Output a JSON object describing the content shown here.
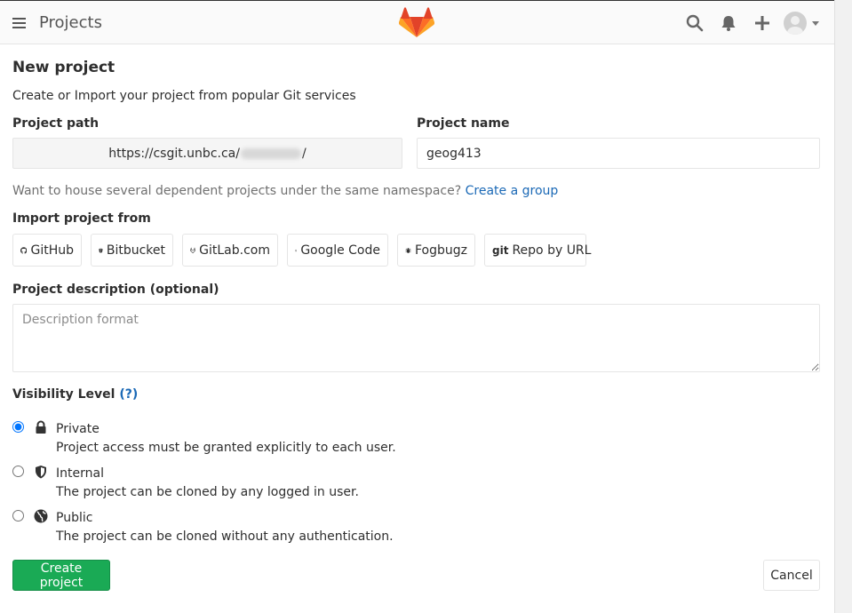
{
  "header": {
    "title": "Projects",
    "icons": [
      "hamburger-icon",
      "gitlab-logo",
      "search-icon",
      "bell-icon",
      "plus-icon",
      "avatar",
      "chevron-down-icon"
    ]
  },
  "page": {
    "title": "New project",
    "subtitle": "Create or Import your project from popular Git services"
  },
  "form": {
    "path_label": "Project path",
    "path_prefix": "https://csgit.unbc.ca/",
    "path_suffix": "/",
    "name_label": "Project name",
    "name_value": "geog413",
    "group_hint": "Want to house several dependent projects under the same namespace?",
    "group_link": "Create a group",
    "import_label": "Import project from",
    "import_options": [
      {
        "label": "GitHub",
        "icon": "github-icon"
      },
      {
        "label": "Bitbucket",
        "icon": "bitbucket-icon"
      },
      {
        "label": "GitLab.com",
        "icon": "gitlab-icon"
      },
      {
        "label": "Google Code",
        "icon": "google-icon"
      },
      {
        "label": "Fogbugz",
        "icon": "bug-icon"
      },
      {
        "label": "Repo by URL",
        "icon": "git-icon"
      }
    ],
    "description_label": "Project description (optional)",
    "description_placeholder": "Description format",
    "visibility_label": "Visibility Level",
    "visibility_help": "(?)",
    "visibility_options": [
      {
        "title": "Private",
        "desc": "Project access must be granted explicitly to each user.",
        "icon": "lock-icon",
        "checked": true
      },
      {
        "title": "Internal",
        "desc": "The project can be cloned by any logged in user.",
        "icon": "shield-icon",
        "checked": false
      },
      {
        "title": "Public",
        "desc": "The project can be cloned without any authentication.",
        "icon": "globe-icon",
        "checked": false
      }
    ],
    "create_label": "Create project",
    "cancel_label": "Cancel"
  },
  "colors": {
    "primary_green": "#1aaa55",
    "link_blue": "#1b69b6",
    "logo_orange": "#fc6d26"
  }
}
